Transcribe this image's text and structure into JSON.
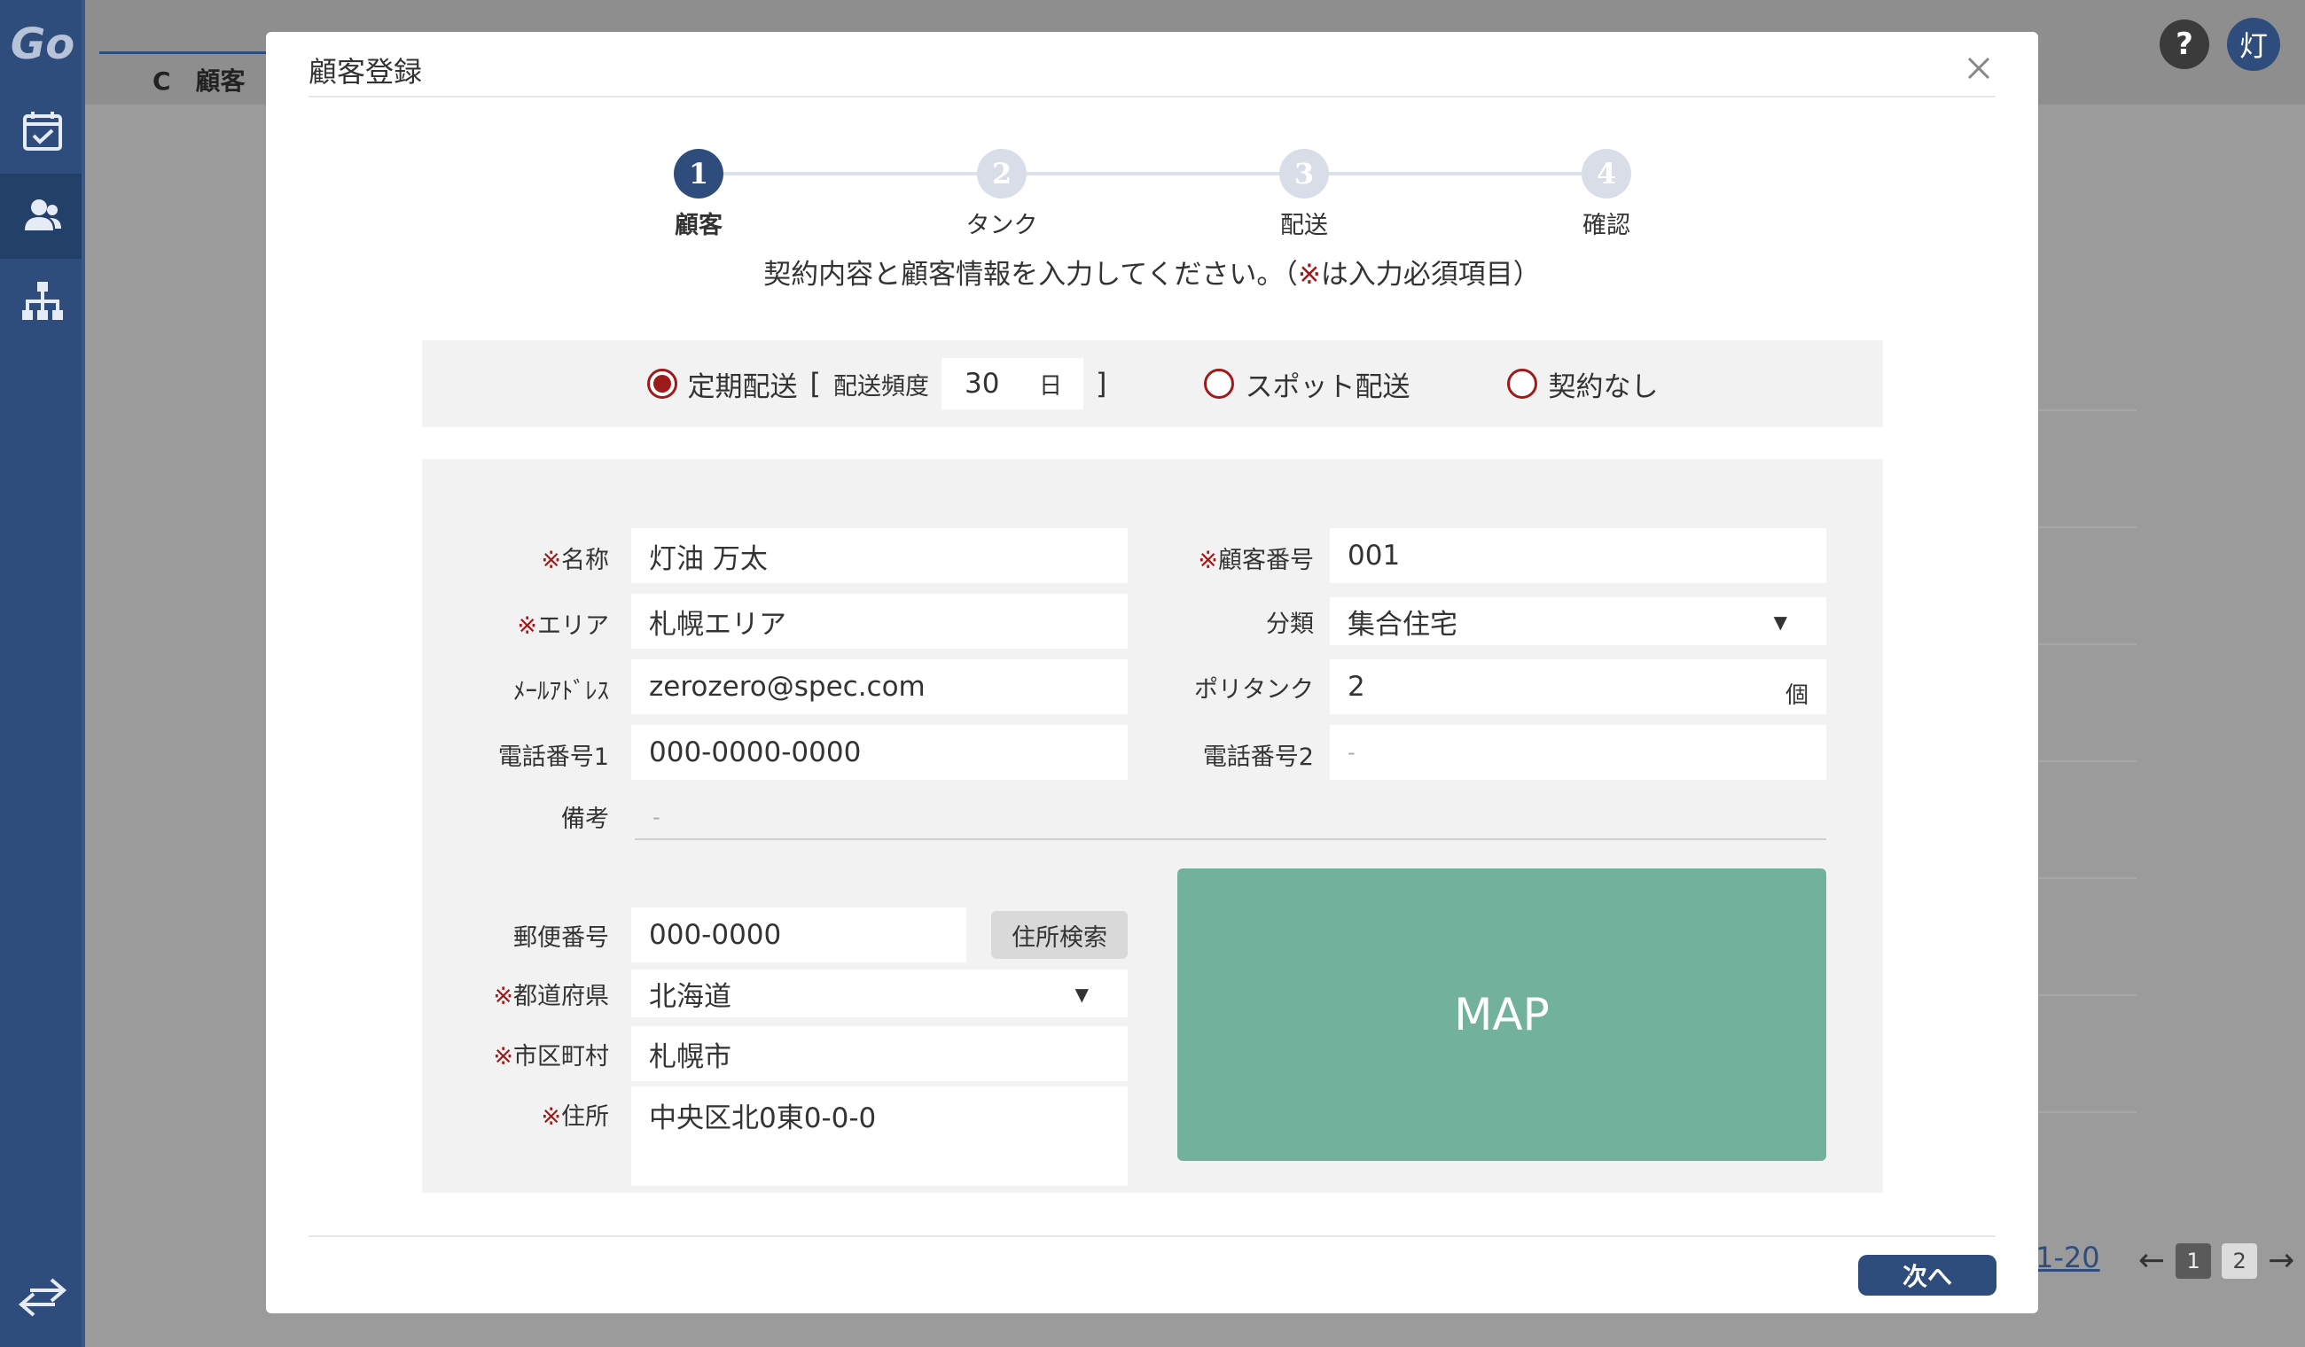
{
  "app": {
    "logo": "Go",
    "page_title": "C　顧客",
    "help_label": "?",
    "user_initial": "灯"
  },
  "sidebar": {
    "items": [
      {
        "icon": "calendar-check-icon"
      },
      {
        "icon": "users-icon",
        "active": true
      },
      {
        "icon": "sitemap-icon"
      }
    ],
    "bottom_icon": "swap-arrows-icon"
  },
  "background_list": {
    "range_label": "1-20",
    "pager": {
      "prev": "←",
      "next": "→",
      "pages": [
        "1",
        "2"
      ],
      "current": "1"
    }
  },
  "modal": {
    "title": "顧客登録",
    "steps": [
      {
        "number": "1",
        "label": "顧客",
        "active": true
      },
      {
        "number": "2",
        "label": "タンク",
        "active": false
      },
      {
        "number": "3",
        "label": "配送",
        "active": false
      },
      {
        "number": "4",
        "label": "確認",
        "active": false
      }
    ],
    "instruction_pre": "契約内容と顧客情報を入力してください。（",
    "instruction_mark": "※",
    "instruction_post": "は入力必須項目）",
    "contract": {
      "regular_label": "定期配送",
      "bracket_open": "[",
      "freq_label": "配送頻度",
      "freq_value": "30",
      "freq_unit": "日",
      "bracket_close": "]",
      "spot_label": "スポット配送",
      "none_label": "契約なし",
      "selected": "regular"
    },
    "form": {
      "required_mark": "※",
      "name": {
        "label": "名称",
        "value": "灯油 万太"
      },
      "customer_no": {
        "label": "顧客番号",
        "value": "001"
      },
      "area": {
        "label": "エリア",
        "value": "札幌エリア"
      },
      "category": {
        "label": "分類",
        "value": "集合住宅"
      },
      "email": {
        "label": "ﾒｰﾙｱﾄﾞﾚｽ",
        "value": "zerozero@spec.com"
      },
      "poly_tank": {
        "label": "ポリタンク",
        "value": "2",
        "unit": "個"
      },
      "phone1": {
        "label": "電話番号1",
        "value": "000-0000-0000"
      },
      "phone2": {
        "label": "電話番号2",
        "value": "-"
      },
      "note": {
        "label": "備考",
        "value": "-"
      },
      "postal": {
        "label": "郵便番号",
        "value": "000-0000"
      },
      "address_search": "住所検索",
      "prefecture": {
        "label": "都道府県",
        "value": "北海道"
      },
      "city": {
        "label": "市区町村",
        "value": "札幌市"
      },
      "address": {
        "label": "住所",
        "value": "中央区北0東0-0-0"
      },
      "map_label": "MAP"
    },
    "next_button": "次へ",
    "dropdown_caret": "▼"
  },
  "colors": {
    "sidebar": "#2f4d7c",
    "accent": "#2f4d7c",
    "required": "#9d1b1b",
    "map": "#72b29d"
  }
}
